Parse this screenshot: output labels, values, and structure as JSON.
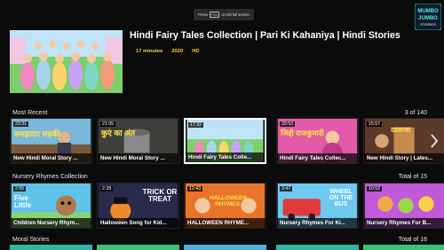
{
  "fullscreen_hint": {
    "before": "Press",
    "key": "F11",
    "after": "to exit full screen"
  },
  "logo": {
    "line1": "MUMBO",
    "line2": "JUMBO",
    "line3": "STORIES"
  },
  "hero": {
    "title": "Hindi Fairy Tales Collection | Pari Ki Kahaniya | Hindi Stories",
    "duration": "17 minutes",
    "year": "2020",
    "quality": "HD"
  },
  "rows": [
    {
      "title": "Most Recent",
      "count": "3 of 140",
      "cards": [
        {
          "duration": "23:31",
          "caption": "New Hindi Moral Story ...",
          "overlay": "समझदार लड़की"
        },
        {
          "duration": "21:05",
          "caption": "New Hindi Moral Story ...",
          "overlay": "कुएं का अंत"
        },
        {
          "duration": "17:32",
          "caption": "Hindi Fairy Tales Colle...",
          "overlay": ""
        },
        {
          "duration": "33:53",
          "caption": "Hindi Fairy Tales Collec...",
          "overlay": "जिद्दी राजकुमारी"
        },
        {
          "duration": "15:57",
          "caption": "New Hindi Story | Lates...",
          "overlay": "दरवाजा"
        }
      ]
    },
    {
      "title": "Nursery Rhymes Collection",
      "count": "Total of 15",
      "cards": [
        {
          "duration": "2:55",
          "caption": "Children Nursery Rhym...",
          "overlay": "Five Little"
        },
        {
          "duration": "2:28",
          "caption": "Halloween Song for Kid...",
          "overlay": "TRICK OR TREAT"
        },
        {
          "duration": "12:43",
          "caption": "HALLOWEEN RHYME...",
          "overlay": "HALLOWEEN RHYMES"
        },
        {
          "duration": "3:47",
          "caption": "Nursery Rhymes For Ki...",
          "overlay": "WHEEL ON THE BUS"
        },
        {
          "duration": "10:52",
          "caption": "Nursery Rhymes For B...",
          "overlay": ""
        }
      ]
    },
    {
      "title": "Moral Stories",
      "count": "Total of 16"
    }
  ],
  "colors": {
    "accent": "#f7d63a",
    "background": "#0b0b0b",
    "selection": "#ffffff"
  },
  "icons": {
    "next": "chevron-right-icon"
  }
}
